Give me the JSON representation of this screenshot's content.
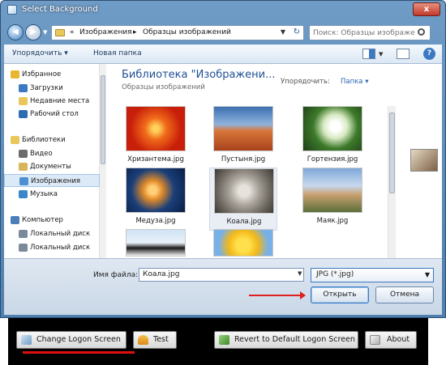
{
  "window": {
    "title": "Select Background",
    "close_label": "x"
  },
  "address": {
    "prefix": "«",
    "crumbs": [
      "Изображения",
      "Образцы изображений"
    ],
    "separator": "▸",
    "search_placeholder": "Поиск: Образцы изображений"
  },
  "toolbar": {
    "organize": "Упорядочить ▾",
    "new_folder": "Новая папка",
    "help": "?"
  },
  "nav": {
    "items": [
      {
        "label": "Избранное",
        "kind": "group",
        "icon": "star-icon",
        "color": "#e8b630"
      },
      {
        "label": "Загрузки",
        "kind": "item",
        "icon": "download-folder-icon",
        "color": "#3b79c2"
      },
      {
        "label": "Недавние места",
        "kind": "item",
        "icon": "recent-places-icon",
        "color": "#e9c75b"
      },
      {
        "label": "Рабочий стол",
        "kind": "item",
        "icon": "desktop-icon",
        "color": "#2f6db1"
      },
      {
        "label": "Библиотеки",
        "kind": "group",
        "icon": "libraries-icon",
        "color": "#e9c75b"
      },
      {
        "label": "Видео",
        "kind": "item",
        "icon": "video-icon",
        "color": "#6b6b6b"
      },
      {
        "label": "Документы",
        "kind": "item",
        "icon": "documents-icon",
        "color": "#d9b55a"
      },
      {
        "label": "Изображения",
        "kind": "item",
        "icon": "pictures-icon",
        "color": "#4d8fd0",
        "selected": true
      },
      {
        "label": "Музыка",
        "kind": "item",
        "icon": "music-icon",
        "color": "#3a86c8"
      },
      {
        "label": "Компьютер",
        "kind": "group",
        "icon": "computer-icon",
        "color": "#4b7fb8"
      },
      {
        "label": "Локальный диск",
        "kind": "item",
        "icon": "drive-icon",
        "color": "#7a8a9a"
      },
      {
        "label": "Локальный диск",
        "kind": "item",
        "icon": "drive-icon",
        "color": "#7a8a9a"
      }
    ]
  },
  "library": {
    "title": "Библиотека \"Изображени...",
    "subtitle": "Образцы изображений",
    "arrange_label": "Упорядочить:",
    "arrange_value": "Папка ▾"
  },
  "files": [
    {
      "name": "Хризантема.jpg",
      "thumb": "radial-gradient(circle, #ffd25a 8%, #f06a1a 30%, #c81e0a 70%)"
    },
    {
      "name": "Пустыня.jpg",
      "thumb": "linear-gradient(#3c6fb0 0%, #8fb3dd 40%, #d9763a 55%, #a8411c 100%)"
    },
    {
      "name": "Гортензия.jpg",
      "thumb": "radial-gradient(circle at 55% 45%, #ffffff 12%, #d7e9c2 30%, #3d7a2a 55%, #1f3e18 100%)"
    },
    {
      "name": "Медуза.jpg",
      "thumb": "radial-gradient(circle at 45% 50%, #ffd078 10%, #e08a2a 25%, #1a3f7a 55%, #0a1d45 100%)"
    },
    {
      "name": "Коала.jpg",
      "thumb": "radial-gradient(circle at 50% 50%, #e6e2dc 15%, #a9a39b 40%, #6f6a62 70%, #3d3a35 100%)",
      "selected": true
    },
    {
      "name": "Маяк.jpg",
      "thumb": "linear-gradient(#7fa8d8 0%, #c8d9ee 40%, #c9a070 60%, #5b6f3a 100%)"
    },
    {
      "name": "",
      "thumb": "linear-gradient(#cfe3f5 0%, #e9f1f8 50%, #1a1a1a 70%, #f0f0f0 100%)"
    },
    {
      "name": "",
      "thumb": "radial-gradient(circle at 50% 60%, #ffe04a 20%, #f2b81a 45%, #78b0e8 75%)"
    }
  ],
  "footer": {
    "filename_label": "Имя файла:",
    "filename_value": "Коала.jpg",
    "filetype_value": "JPG (*.jpg)",
    "open_label": "Открыть",
    "cancel_label": "Отмена"
  },
  "app": {
    "change_logon": "Change Logon Screen",
    "test": "Test",
    "revert": "Revert to Default Logon Screen",
    "about": "About"
  },
  "colors": {
    "accent_red": "#e01010",
    "title_blue": "#1e4f96",
    "selection": "#dce9f7"
  }
}
